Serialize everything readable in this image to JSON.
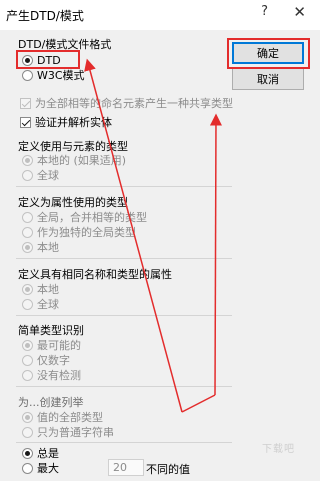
{
  "window": {
    "title": "产生DTD/模式",
    "help_glyph": "?",
    "close_glyph": "✕"
  },
  "buttons": {
    "ok": "确定",
    "cancel": "取消"
  },
  "format_group": {
    "title": "DTD/模式文件格式",
    "options": [
      "DTD",
      "W3C模式"
    ]
  },
  "checkboxes": {
    "shared_type": "为全部相等的命名元素产生一种共享类型",
    "validate": "验证并解析实体"
  },
  "element_type_group": {
    "title": "定义使用与元素的类型",
    "options": [
      "本地的 (如果适用)",
      "全球"
    ]
  },
  "attr_type_group": {
    "title": "定义为属性使用的类型",
    "options": [
      "全局，合并相等的类型",
      "作为独特的全局类型",
      "本地"
    ]
  },
  "same_name_group": {
    "title": "定义具有相同名称和类型的属性",
    "options": [
      "本地",
      "全球"
    ]
  },
  "simple_type_group": {
    "title": "简单类型识别",
    "options": [
      "最可能的",
      "仅数字",
      "没有检测"
    ]
  },
  "enum_group": {
    "title": "为...创建列举",
    "options": [
      "值的全部类型",
      "只为普通字符串"
    ]
  },
  "limit_group": {
    "options": [
      "总是",
      "最大"
    ],
    "max_value": "20",
    "max_suffix": "不同的值"
  },
  "watermark": "下载吧"
}
